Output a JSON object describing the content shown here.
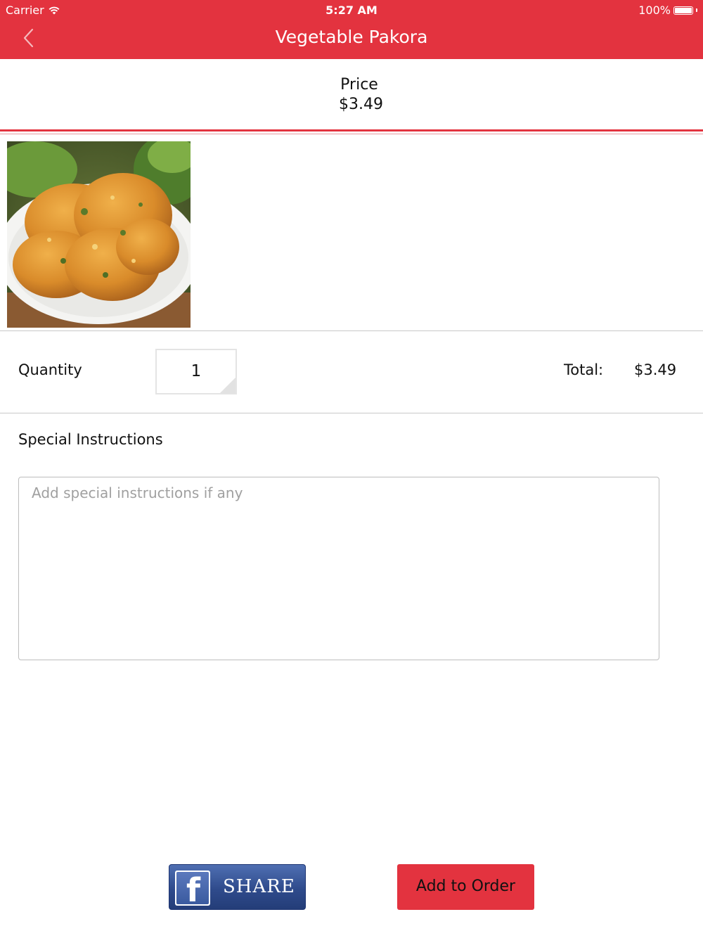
{
  "status_bar": {
    "carrier": "Carrier",
    "time": "5:27 AM",
    "battery": "100%"
  },
  "nav": {
    "title": "Vegetable Pakora",
    "back_icon": "chevron-left-icon"
  },
  "price": {
    "label": "Price",
    "value": "$3.49"
  },
  "item": {
    "image": "vegetable-pakora-photo"
  },
  "quantity": {
    "label": "Quantity",
    "value": "1"
  },
  "total": {
    "label": "Total:",
    "value": "$3.49"
  },
  "special_instructions": {
    "label": "Special Instructions",
    "placeholder": "Add special instructions if any"
  },
  "actions": {
    "share_label": "SHARE",
    "share_icon": "facebook-icon",
    "add_label": "Add to Order"
  },
  "colors": {
    "accent": "#e3333f",
    "facebook": "#3b5998"
  }
}
